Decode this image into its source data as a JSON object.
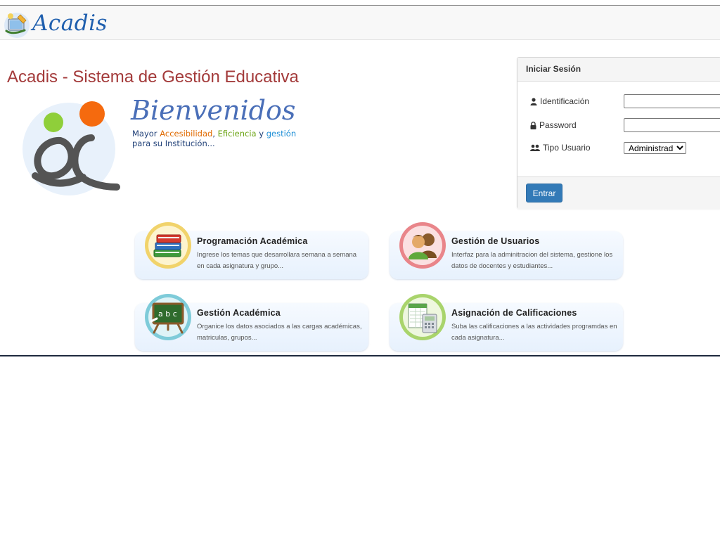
{
  "brand": {
    "name": "Acadis"
  },
  "page_title": "Acadis - Sistema de Gestión Educativa",
  "welcome": {
    "heading": "Bienvenidos",
    "tagline_prefix": "Mayor ",
    "word_1": "Accesibilidad",
    "sep_1": ", ",
    "word_2": "Eficiencia",
    "sep_2": " y ",
    "word_3": "gestión",
    "line_2": "para su Institución..."
  },
  "login": {
    "heading": "Iniciar Sesión",
    "identificacion_label": "Identificación",
    "identificacion_value": "",
    "password_label": "Password",
    "password_value": "",
    "tipo_usuario_label": "Tipo Usuario",
    "tipo_usuario_selected": "Administrador",
    "submit_label": "Entrar"
  },
  "features": [
    {
      "title": "Programación Académica",
      "description": "Ingrese los temas que desarrollara semana a semana en cada asignatura y grupo...",
      "icon": "books-icon",
      "ring_color": "#f1d36b"
    },
    {
      "title": "Gestión de Usuarios",
      "description": "Interfaz para la adminitracion del sistema, gestione los datos de docentes y estudiantes...",
      "icon": "users-icon",
      "ring_color": "#e9858a"
    },
    {
      "title": "Gestión Académica",
      "description": "Organice los datos asociados a las cargas académicas, matriculas, grupos...",
      "icon": "chalkboard-icon",
      "ring_color": "#7ecbd9"
    },
    {
      "title": "Asignación de Calificaciones",
      "description": "Suba las calificaciones a las actividades programdas en cada asignatura...",
      "icon": "grades-icon",
      "ring_color": "#a9d46c"
    }
  ]
}
